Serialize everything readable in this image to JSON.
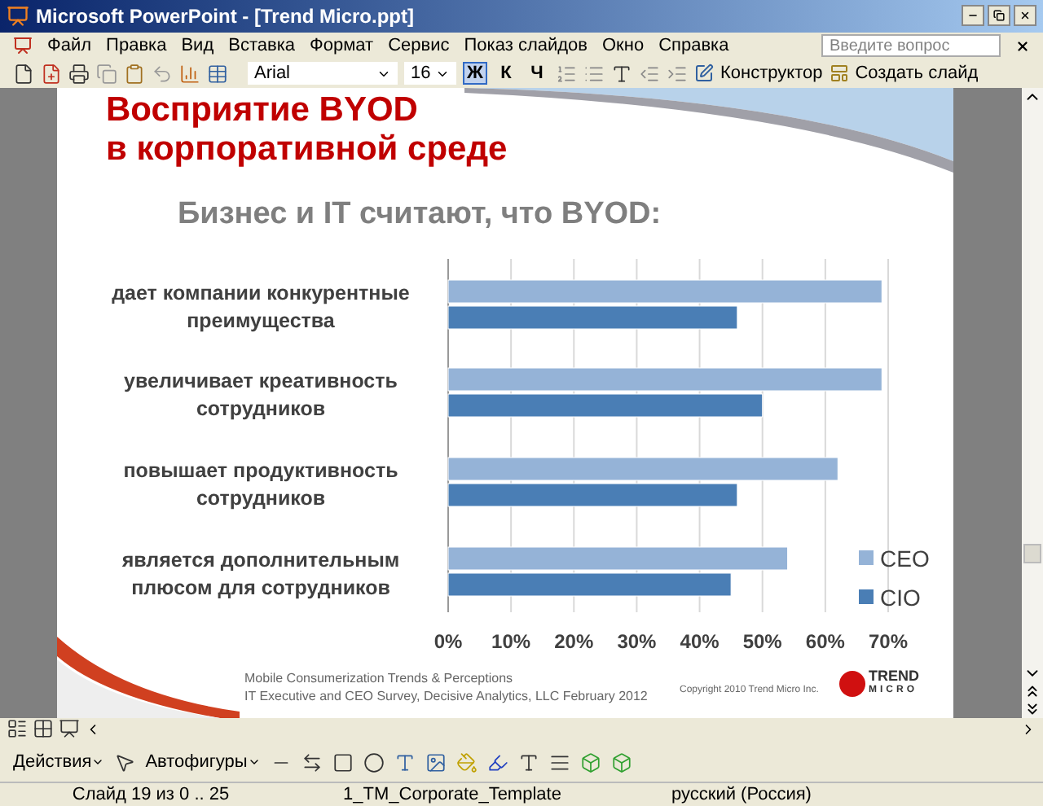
{
  "window": {
    "title": "Microsoft PowerPoint - [Trend Micro.ppt]"
  },
  "menu": [
    "Файл",
    "Правка",
    "Вид",
    "Вставка",
    "Формат",
    "Сервис",
    "Показ слайдов",
    "Окно",
    "Справка"
  ],
  "help_box": {
    "placeholder": "Введите вопрос"
  },
  "toolbar": {
    "font": "Arial",
    "size": "16",
    "format_buttons": [
      {
        "label": "Ж",
        "selected": true
      },
      {
        "label": "К",
        "selected": false
      },
      {
        "label": "Ч",
        "selected": false
      }
    ],
    "designer": "Конструктор",
    "new_slide": "Создать слайд"
  },
  "slide": {
    "title_line1": "Восприятие BYOD",
    "title_line2": "в корпоративной среде",
    "subtitle": "Бизнес и IT считают, что BYOD:",
    "chart_data": {
      "type": "bar",
      "orientation": "horizontal",
      "categories": [
        "дает компании конкурентные преимущества",
        "увеличивает креативность сотрудников",
        "повышает продуктивность сотрудников",
        "является дополнительным плюсом для сотрудников"
      ],
      "series": [
        {
          "name": "CEO",
          "color": "#95b3d7",
          "values": [
            69,
            69,
            62,
            54
          ]
        },
        {
          "name": "CIO",
          "color": "#4a7eb5",
          "values": [
            46,
            50,
            46,
            45
          ]
        }
      ],
      "xlim": [
        0,
        70
      ],
      "grid": true,
      "legend": true,
      "xticks": [
        {
          "value": 0,
          "label": "0%"
        },
        {
          "value": 10,
          "label": "10%"
        },
        {
          "value": 20,
          "label": "20%"
        },
        {
          "value": 30,
          "label": "30%"
        },
        {
          "value": 40,
          "label": "40%"
        },
        {
          "value": 50,
          "label": "50%"
        },
        {
          "value": 60,
          "label": "60%"
        },
        {
          "value": 70,
          "label": "70%"
        }
      ]
    },
    "source_line1": "Mobile Consumerization Trends & Perceptions",
    "source_line2": "IT Executive and CEO Survey, Decisive Analytics, LLC February 2012",
    "copyright": "Copyright 2010 Trend Micro Inc.",
    "logo_line1": "TREND",
    "logo_line2": "MICRO"
  },
  "drawing_toolbar": {
    "actions": "Действия",
    "autoshapes": "Автофигуры"
  },
  "status_bar": [
    "Слайд 19 из 0 .. 25",
    "1_TM_Corporate_Template",
    "русский (Россия)"
  ]
}
